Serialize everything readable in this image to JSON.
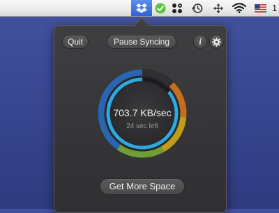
{
  "menubar": {
    "icons": [
      "dropbox-icon",
      "check-icon",
      "dots-grid-icon",
      "time-machine-icon",
      "arrows-icon",
      "wifi-icon",
      "us-flag-icon"
    ],
    "clipped_text": "1"
  },
  "popup": {
    "quit_label": "Quit",
    "pause_label": "Pause Syncing",
    "info_label": "i",
    "speed": "703.7 KB/sec",
    "time_left": "24 sec left",
    "more_space_label": "Get More Space",
    "progress": 0.86,
    "colors": {
      "accent_blue": "#2ea8e0",
      "ring_orange": "#e07a1a",
      "ring_yellow": "#d9b216",
      "ring_green": "#7bb33a",
      "ring_blue": "#2a70c8"
    }
  }
}
